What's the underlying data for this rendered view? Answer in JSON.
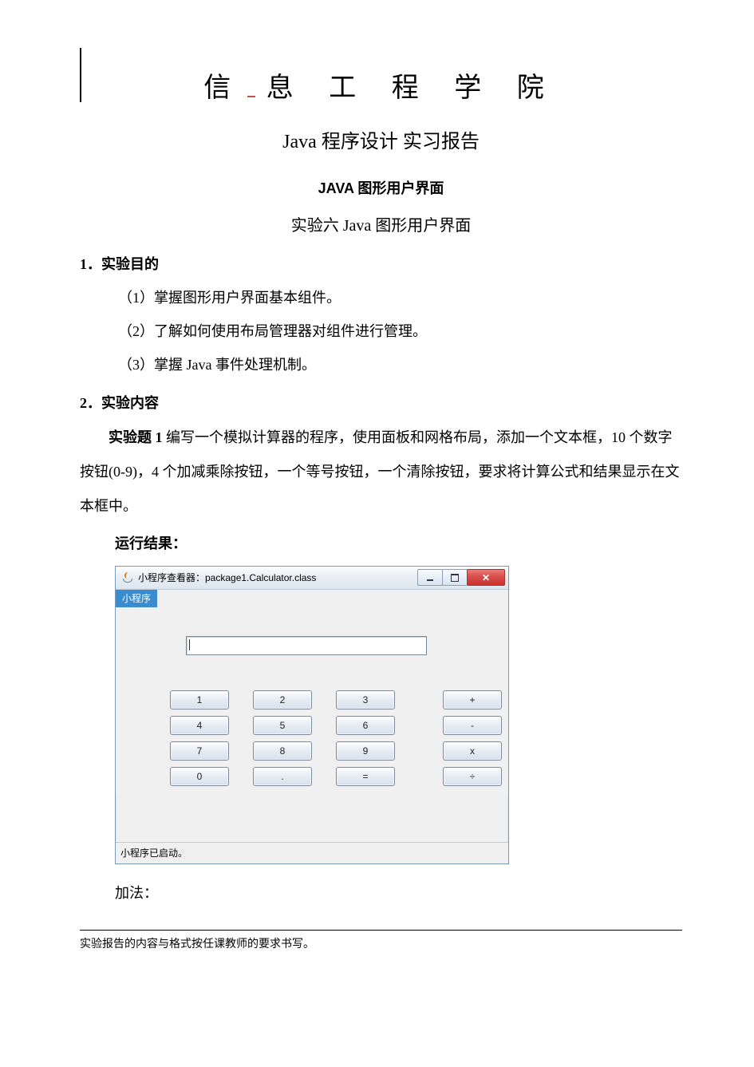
{
  "header": {
    "institution": "信 息 工 程 学 院",
    "report_line": "Java 程序设计 实习报告",
    "section_title": "JAVA 图形用户界面",
    "experiment_title": "实验六 Java 图形用户界面"
  },
  "objectives_heading": "1．实验目的",
  "objectives": [
    "（1）掌握图形用户界面基本组件。",
    "（2）了解如何使用布局管理器对组件进行管理。",
    "（3）掌握 Java 事件处理机制。"
  ],
  "content_heading": "2．实验内容",
  "task_label": "实验题 1",
  "task_body": "  编写一个模拟计算器的程序，使用面板和网格布局，添加一个文本框，10 个数字按钮(0-9)，4 个加减乘除按钮，一个等号按钮，一个清除按钮，要求将计算公式和结果显示在文本框中。",
  "run_result_label": "运行结果：",
  "applet": {
    "title": "小程序查看器：package1.Calculator.class",
    "menu": "小程序",
    "status": "小程序已启动。",
    "display_value": "",
    "buttons": {
      "r0": [
        "1",
        "2",
        "3",
        "+"
      ],
      "r1": [
        "4",
        "5",
        "6",
        "-"
      ],
      "r2": [
        "7",
        "8",
        "9",
        "x"
      ],
      "r3": [
        "0",
        ".",
        "=",
        "÷"
      ]
    }
  },
  "addition_label": "加法：",
  "footnote": "实验报告的内容与格式按任课教师的要求书写。"
}
